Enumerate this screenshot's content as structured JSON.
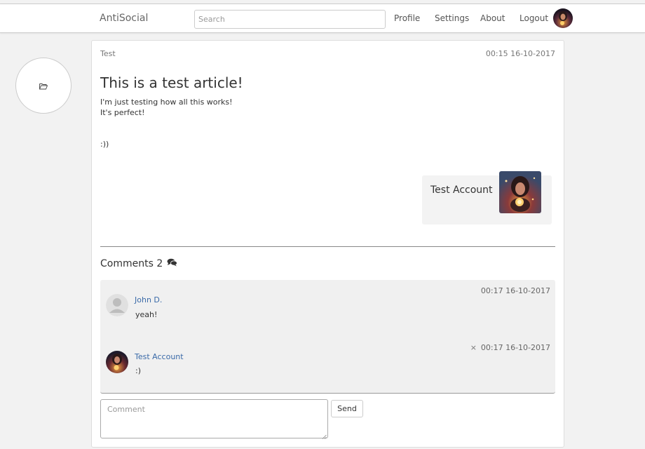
{
  "navbar": {
    "brand": "AntiSocial",
    "search_placeholder": "Search",
    "links": [
      "Profile",
      "Settings",
      "About",
      "Logout"
    ]
  },
  "post": {
    "category": "Test",
    "date": "00:15 16-10-2017",
    "title": "This is a test article!",
    "body_lines": [
      "I'm just testing how all this works!",
      "It's perfect!",
      "",
      "",
      ":))"
    ],
    "author_name": "Test Account"
  },
  "comments": {
    "heading": "Comments 2",
    "items": [
      {
        "author": "John D.",
        "text": "yeah!",
        "date": "00:17 16-10-2017",
        "avatar": "default-user-icon"
      },
      {
        "author": "Test Account",
        "text": ":)",
        "date": "00:17 16-10-2017",
        "delete": "×",
        "avatar": "photo"
      }
    ]
  },
  "comment_form": {
    "placeholder": "Comment",
    "send_label": "Send"
  },
  "colors": {
    "link_blue": "#3a6aa8",
    "background": "#f2f2f2"
  }
}
